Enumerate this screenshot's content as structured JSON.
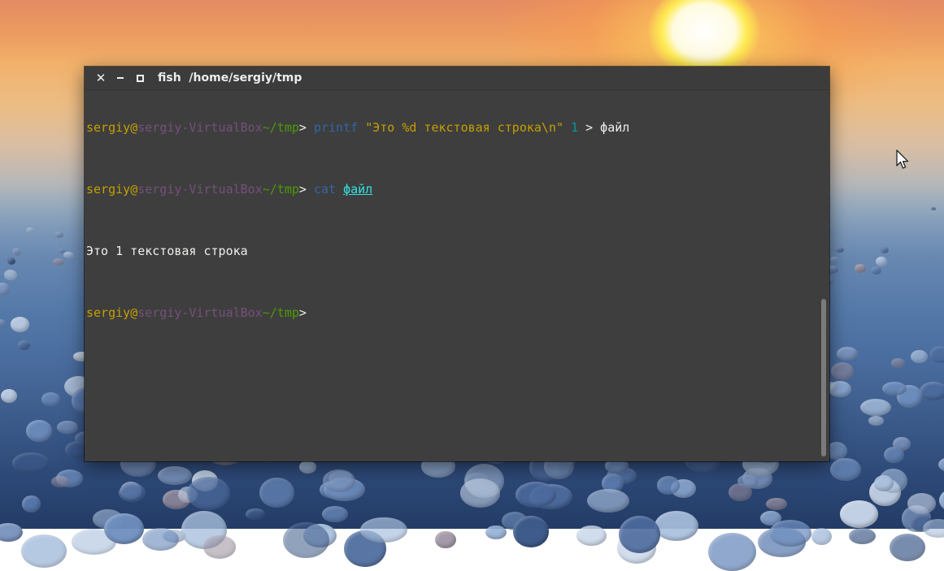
{
  "window": {
    "title": "fish  /home/sergiy/tmp",
    "close_glyph": "✕",
    "close_icon": "close-icon",
    "minimize_icon": "minimize-icon",
    "maximize_icon": "maximize-icon"
  },
  "terminal": {
    "lines": [
      {
        "user": "sergiy",
        "at": "@",
        "host": "sergiy-VirtualBox",
        "cwd": "~/tmp",
        "prompt": "> ",
        "cmd": "printf",
        "sp1": " ",
        "str": "\"Это %d текстовая строка\\n\"",
        "sp2": " ",
        "num": "1",
        "rest": " > файл"
      },
      {
        "user": "sergiy",
        "at": "@",
        "host": "sergiy-VirtualBox",
        "cwd": "~/tmp",
        "prompt": "> ",
        "cmd": "cat",
        "sp1": " ",
        "link": "файл"
      },
      {
        "output": "Это 1 текстовая строка"
      },
      {
        "user": "sergiy",
        "at": "@",
        "host": "sergiy-VirtualBox",
        "cwd": "~/tmp",
        "prompt": ">"
      }
    ]
  },
  "colors": {
    "terminal_bg": "#3e3e3e",
    "user": "#c4a000",
    "host": "#75507b",
    "cwd": "#4e9a06",
    "command": "#3465a4",
    "string": "#c4a000",
    "number": "#06989a",
    "path_link": "#34e2e2"
  }
}
